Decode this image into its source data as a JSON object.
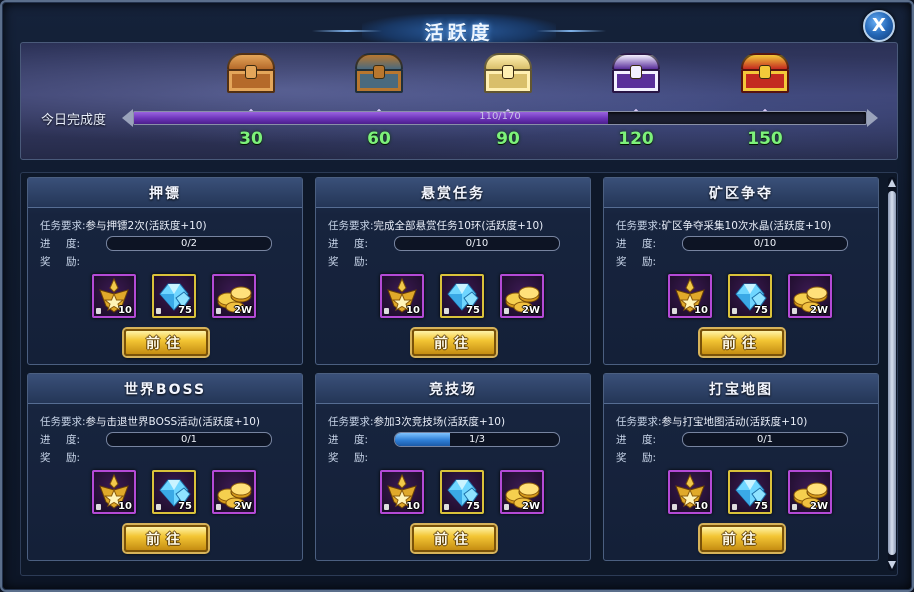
{
  "window": {
    "title": "活跃度",
    "close_label": "X"
  },
  "activity": {
    "label": "今日完成度",
    "current": 110,
    "max": 170,
    "progress_text": "110/170",
    "milestones": [
      {
        "value": "30",
        "chest_color": "#b56a2a",
        "chest_accent": "#e4a65a",
        "icon": "wooden-chest-icon"
      },
      {
        "value": "60",
        "chest_color": "#4a6a7e",
        "chest_accent": "#b8772f",
        "icon": "iron-chest-icon"
      },
      {
        "value": "90",
        "chest_color": "#d9bf6a",
        "chest_accent": "#fff0b2",
        "icon": "gold-chest-icon"
      },
      {
        "value": "120",
        "chest_color": "#5a2f9a",
        "chest_accent": "#f3f0ff",
        "icon": "silver-purple-chest-icon"
      },
      {
        "value": "150",
        "chest_color": "#c32a20",
        "chest_accent": "#f3c83a",
        "icon": "red-gold-chest-icon"
      }
    ]
  },
  "labels": {
    "requirement": "任务要求:",
    "progress_a": "进",
    "progress_b": "度:",
    "reward_a": "奖",
    "reward_b": "励:",
    "goto": "前往"
  },
  "rewards": [
    {
      "icon": "star-crest-icon",
      "qty": "10",
      "frame": "purple"
    },
    {
      "icon": "blue-crystal-icon",
      "qty": "75",
      "frame": "gold"
    },
    {
      "icon": "gold-coins-icon",
      "qty": "2W",
      "frame": "purple"
    }
  ],
  "quests": [
    {
      "title": "押镖",
      "requirement": "参与押镖2次(活跃度+10)",
      "progress_text": "0/2",
      "progress": 0
    },
    {
      "title": "悬赏任务",
      "requirement": "完成全部悬赏任务10环(活跃度+10)",
      "progress_text": "0/10",
      "progress": 0
    },
    {
      "title": "矿区争夺",
      "requirement": "矿区争夺采集10次水晶(活跃度+10)",
      "progress_text": "0/10",
      "progress": 0
    },
    {
      "title": "世界BOSS",
      "requirement": "参与击退世界BOSS活动(活跃度+10)",
      "progress_text": "0/1",
      "progress": 0
    },
    {
      "title": "竞技场",
      "requirement": "参加3次竞技场(活跃度+10)",
      "progress_text": "1/3",
      "progress": 0.333
    },
    {
      "title": "打宝地图",
      "requirement": "参与打宝地图活动(活跃度+10)",
      "progress_text": "0/1",
      "progress": 0
    }
  ]
}
